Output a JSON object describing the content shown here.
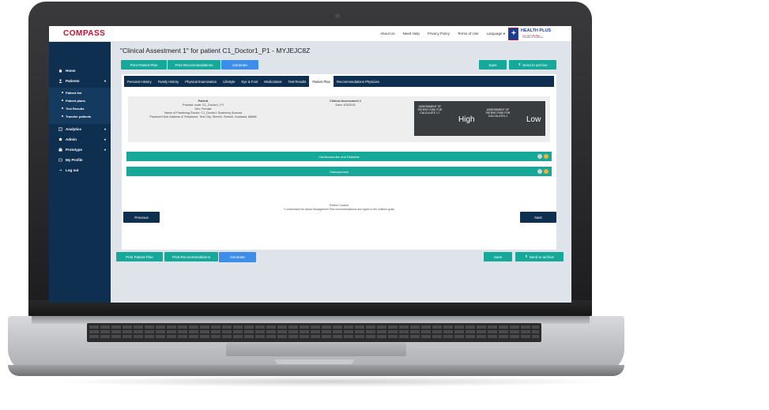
{
  "app": {
    "logo": "COMPASS"
  },
  "top_links": [
    "About Us",
    "Need Help",
    "Privacy Policy",
    "Terms of Use",
    "Language ▾"
  ],
  "partner_logo": {
    "name": "HEALTH PLUS",
    "tagline": "ALL IN THE MIX",
    "sub": "innovation in healthcare"
  },
  "sidebar": {
    "home": "Home",
    "patients": "Patients",
    "sub_items": [
      "Patient list",
      "Patient plans",
      "Test Results",
      "Transfer patients"
    ],
    "analytics": "Analytics",
    "admin": "Admin",
    "prototype": "Prototype",
    "my_profile": "My Profile",
    "log_out": "Log out"
  },
  "page": {
    "title": "\"Clinical Assestment 1\" for patient C1_Doctor1_P1 - MYJEJC8Z"
  },
  "toolbar": {
    "print_patient_plan": "Print Patient Plan",
    "print_recommendations": "Print Recommendations",
    "generate": "Generate",
    "save": "Save",
    "send_to_archive": "Send to archive"
  },
  "tabs": [
    "Personal History",
    "Family History",
    "Physical Examination",
    "Lifestyle",
    "Eye & Foot",
    "Medications",
    "Test Results",
    "Patient Plan",
    "Recommendations Physician"
  ],
  "active_tab": "Patient Plan",
  "patient_info": {
    "heading": "Patient",
    "practice_code": "Practice code: C1_Doctor1_P1",
    "sex": "Sex: Female",
    "doctor": "Name of Practicing Doctor: C1_Doctor1 Scarberry Burruss",
    "address": "Practice/Clinic Address & Telephone: Test City, Street1, Street2, Australia, 88888"
  },
  "assessment_info": {
    "heading": "Clinical Assessment 1",
    "date": "Date: 6/3/2018"
  },
  "risk": [
    {
      "label": "ASSESSMENT OF PATIENT RISK FOR CALCULATE 1.7",
      "value": "High"
    },
    {
      "label": "ASSESSMENT OF PATIENT RISK FOR CALCULATE1.1",
      "value": "Low"
    }
  ],
  "sections": [
    "Cardiovascular and Diabetes",
    "Osteoporosis"
  ],
  "consent": {
    "heading": "Patient Consent",
    "text": "*I understand the above Management Plan recommendations and agree to the outlined goals"
  },
  "pager": {
    "previous": "Previous",
    "next": "Next"
  },
  "colors": {
    "navy": "#0f2f50",
    "teal": "#16a99a",
    "blue": "#3d8ee8",
    "brand_red": "#c8102e"
  },
  "icons": [
    "home-icon",
    "patients-icon",
    "analytics-icon",
    "admin-icon",
    "prototype-icon",
    "profile-icon",
    "logout-icon",
    "archive-icon"
  ]
}
